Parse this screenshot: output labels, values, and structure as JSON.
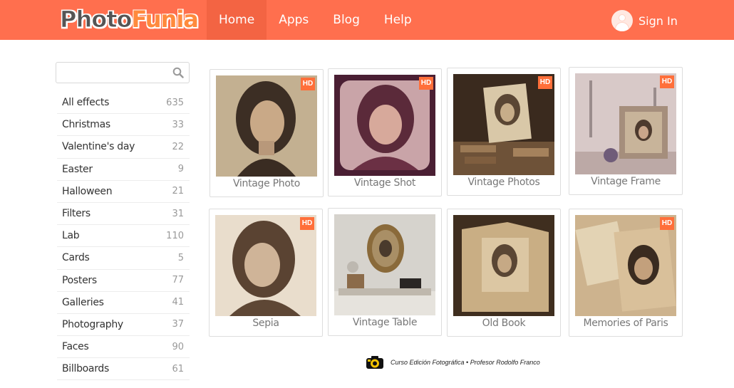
{
  "header": {
    "logo_part1": "Photo",
    "logo_part2": "Funia",
    "nav": [
      {
        "label": "Home",
        "active": true
      },
      {
        "label": "Apps",
        "active": false
      },
      {
        "label": "Blog",
        "active": false
      },
      {
        "label": "Help",
        "active": false
      }
    ],
    "signin_label": "Sign In"
  },
  "search": {
    "value": "",
    "placeholder": ""
  },
  "categories": [
    {
      "label": "All effects",
      "count": "635"
    },
    {
      "label": "Christmas",
      "count": "33"
    },
    {
      "label": "Valentine's day",
      "count": "22"
    },
    {
      "label": "Easter",
      "count": "9"
    },
    {
      "label": "Halloween",
      "count": "21"
    },
    {
      "label": "Filters",
      "count": "31"
    },
    {
      "label": "Lab",
      "count": "110"
    },
    {
      "label": "Cards",
      "count": "5"
    },
    {
      "label": "Posters",
      "count": "77"
    },
    {
      "label": "Galleries",
      "count": "41"
    },
    {
      "label": "Photography",
      "count": "37"
    },
    {
      "label": "Faces",
      "count": "90"
    },
    {
      "label": "Billboards",
      "count": "61"
    }
  ],
  "effects": [
    {
      "title": "Vintage Photo",
      "badge": "HD"
    },
    {
      "title": "Vintage Shot",
      "badge": "HD"
    },
    {
      "title": "Vintage Photos",
      "badge": "HD"
    },
    {
      "title": "Vintage Frame",
      "badge": "HD"
    },
    {
      "title": "Sepia",
      "badge": "HD"
    },
    {
      "title": "Vintage Table",
      "badge": ""
    },
    {
      "title": "Old Book",
      "badge": ""
    },
    {
      "title": "Memories of Paris",
      "badge": "HD"
    }
  ],
  "credit": {
    "text": "Curso Edición Fotográfica • Profesor Rodolfo Franco"
  },
  "colors": {
    "header": "#ff6f4e",
    "nav_active": "#f36443",
    "hd_badge": "#ff6f3a"
  }
}
